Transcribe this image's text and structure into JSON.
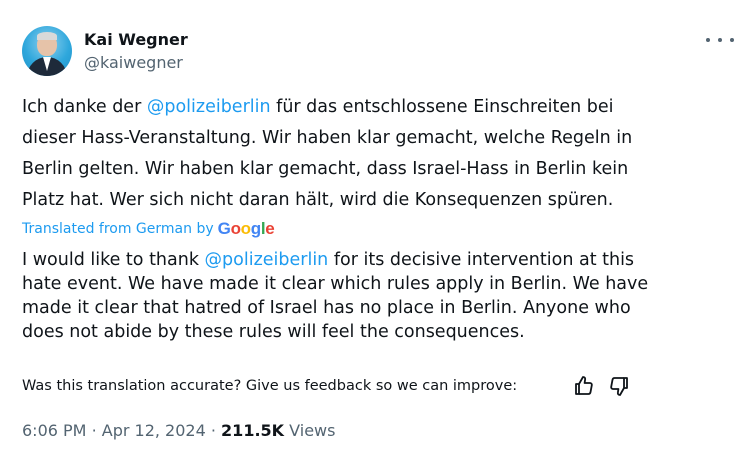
{
  "author": {
    "name": "Kai Wegner",
    "handle": "@kaiwegner",
    "avatar_icon": "profile-photo"
  },
  "original": {
    "line1_pre": "Ich danke der ",
    "line1_mention": "@polizeiberlin",
    "line1_post": " für das entschlossene Einschreiten bei",
    "line2": "dieser Hass-Veranstaltung. Wir haben klar gemacht, welche Regeln in",
    "line3": "Berlin gelten. Wir haben klar gemacht, dass Israel-Hass in Berlin kein",
    "line4": "Platz hat. Wer sich nicht daran hält, wird die Konsequenzen spüren."
  },
  "translation_note": {
    "prefix": "Translated from German by",
    "brand": "Google"
  },
  "translated": {
    "line1_pre": "I would like to thank ",
    "line1_mention": "@polizeiberlin",
    "line1_post": " for its decisive intervention at this",
    "line2": "hate event. We have made it clear which rules apply in Berlin. We have",
    "line3": "made it clear that hatred of Israel has no place in Berlin. Anyone who",
    "line4": "does not abide by these rules will feel the consequences."
  },
  "feedback": {
    "prompt": "Was this translation accurate? Give us feedback so we can improve:",
    "icons": [
      "thumbs-up-icon",
      "thumbs-down-icon"
    ]
  },
  "meta": {
    "time": "6:06 PM",
    "separator": "·",
    "date": "Apr 12, 2024",
    "views_count": "211.5K",
    "views_label": "Views"
  },
  "colors": {
    "link": "#1d9bf0",
    "secondary_text": "#536471",
    "primary_text": "#0f1419"
  }
}
